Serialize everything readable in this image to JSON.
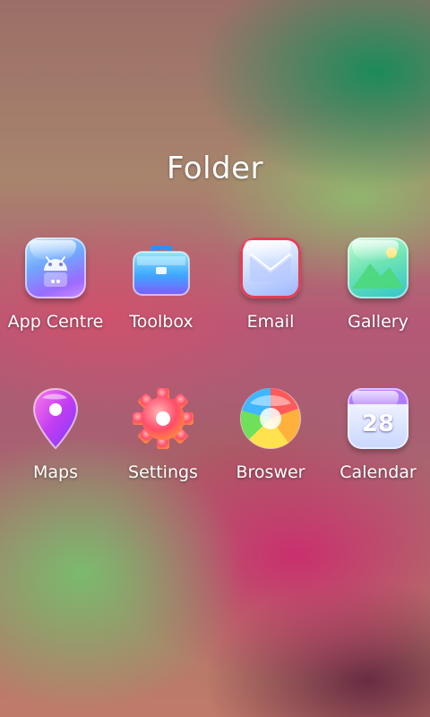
{
  "folder": {
    "title": "Folder"
  },
  "apps": [
    {
      "label": "App Centre",
      "icon": "android-icon"
    },
    {
      "label": "Toolbox",
      "icon": "briefcase-icon"
    },
    {
      "label": "Email",
      "icon": "envelope-icon"
    },
    {
      "label": "Gallery",
      "icon": "picture-icon"
    },
    {
      "label": "Maps",
      "icon": "map-pin-icon"
    },
    {
      "label": "Settings",
      "icon": "gear-icon"
    },
    {
      "label": "Broswer",
      "icon": "browser-icon"
    },
    {
      "label": "Calendar",
      "icon": "calendar-icon",
      "date": "28"
    }
  ]
}
